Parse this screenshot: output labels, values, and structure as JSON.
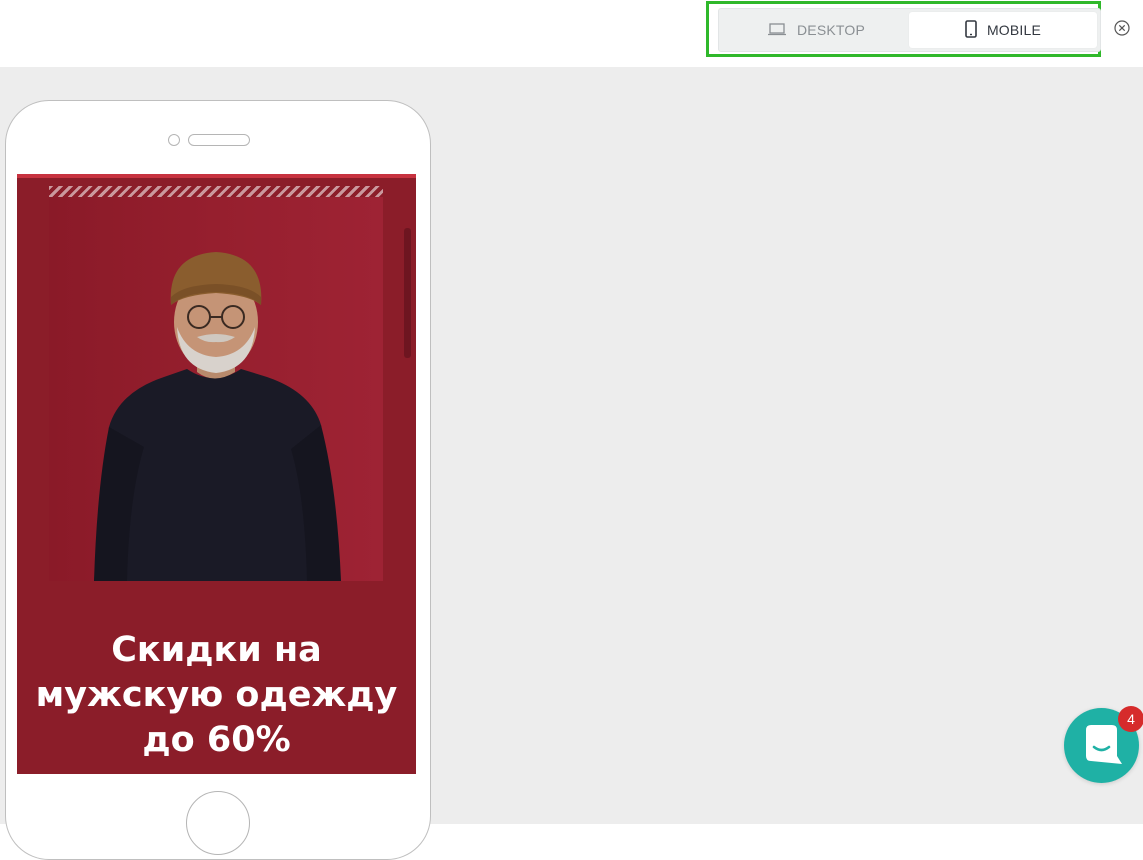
{
  "toolbar": {
    "view_options": [
      {
        "label": "DESKTOP",
        "icon": "laptop-icon",
        "selected": false
      },
      {
        "label": "MOBILE",
        "icon": "smartphone-icon",
        "selected": true
      }
    ],
    "close_icon": "close-circle-icon",
    "highlight_color": "#2fb82a"
  },
  "preview": {
    "promo_heading_lines": [
      "Скидки на",
      "мужскую одежду",
      "до 60%"
    ],
    "banner_color": "#8b1d29",
    "photo_subject": "man-in-beanie-image"
  },
  "chat": {
    "icon": "chat-bubble-icon",
    "unread_count": "4",
    "color": "#1fb1a5"
  }
}
